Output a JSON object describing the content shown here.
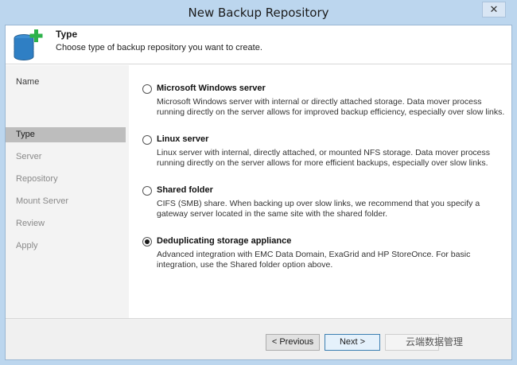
{
  "window": {
    "title": "New Backup Repository",
    "close_glyph": "✕"
  },
  "header": {
    "title": "Type",
    "subtitle": "Choose type of backup repository you want to create.",
    "icon": "database-add-icon"
  },
  "sidebar": {
    "items": [
      {
        "label": "Name",
        "state": "done"
      },
      {
        "label": "Type",
        "state": "active"
      },
      {
        "label": "Server",
        "state": "pending"
      },
      {
        "label": "Repository",
        "state": "pending"
      },
      {
        "label": "Mount Server",
        "state": "pending"
      },
      {
        "label": "Review",
        "state": "pending"
      },
      {
        "label": "Apply",
        "state": "pending"
      }
    ]
  },
  "options": [
    {
      "title": "Microsoft Windows server",
      "description": "Microsoft Windows server with internal or directly attached storage. Data mover process running directly on the server allows for improved backup efficiency, especially over slow links.",
      "selected": false
    },
    {
      "title": "Linux server",
      "description": "Linux server with internal, directly attached, or mounted NFS storage. Data mover process running directly on the server allows for more efficient backups, especially over slow links.",
      "selected": false
    },
    {
      "title": "Shared folder",
      "description": "CIFS (SMB) share. When backing up over slow links, we recommend that you specify a gateway server located in the same site with the shared folder.",
      "selected": false
    },
    {
      "title": "Deduplicating storage appliance",
      "description": "Advanced integration with EMC Data Domain, ExaGrid and HP StoreOnce. For basic integration, use the Shared folder option above.",
      "selected": true
    }
  ],
  "footer": {
    "previous_label": "< Previous",
    "next_label": "Next >",
    "finish_label": ""
  },
  "watermark": {
    "text": "云端数据管理"
  },
  "colors": {
    "titlebar": "#bcd6ee",
    "active_nav": "#bdbdbd",
    "sidebar_bg": "#f3f3f3",
    "plus_green": "#2db24a",
    "db_blue": "#2f7fc4"
  }
}
